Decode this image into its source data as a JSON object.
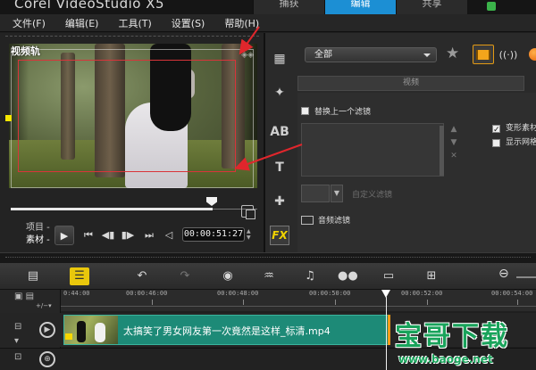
{
  "window": {
    "app_title": "Corel VideoStudio X5",
    "step_tabs": [
      "捕获",
      "编辑",
      "共享"
    ]
  },
  "menu": {
    "file": "文件(F)",
    "edit": "编辑(E)",
    "tools": "工具(T)",
    "settings": "设置(S)",
    "help": "帮助(H)"
  },
  "preview": {
    "track_label": "视频轨",
    "mode_project": "项目 -",
    "mode_clip": "素材 -",
    "timecode": "00:00:51:27",
    "play_icon": "play-icon"
  },
  "library": {
    "category_selected": "全部",
    "section_header": "视频",
    "replace_last_filter": "替换上一个滤镜",
    "deform_clip": "变形素材",
    "show_grid": "显示网格线",
    "custom_filter_button": "自定义滤镜",
    "audio_filter": "音频滤镜",
    "side_labels": [
      "AB",
      "T",
      "FX"
    ]
  },
  "timeline": {
    "ruler_ticks": [
      "0:44:00",
      "00:00:46:00",
      "00:00:48:00",
      "00:00:50:00",
      "00:00:52:00",
      "00:00:54:00"
    ],
    "clip_title": "太搞笑了男女网友第一次竟然是这样_标清.mp4"
  },
  "branding": {
    "title": "宝哥下载",
    "url": "www.baoge.net"
  },
  "colors": {
    "accent_tab": "#1c8fd4",
    "clip": "#1d8a77",
    "arrow": "#e0262c",
    "brand": "#19a35b"
  }
}
